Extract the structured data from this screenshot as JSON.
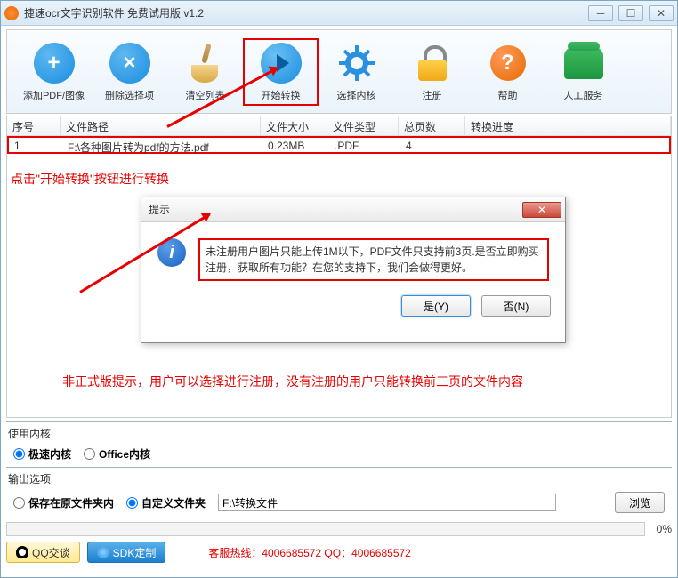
{
  "window": {
    "title": "捷速ocr文字识别软件 免费试用版 v1.2"
  },
  "toolbar": {
    "add": "添加PDF/图像",
    "delete": "删除选择项",
    "clear": "清空列表",
    "start": "开始转换",
    "engine": "选择内核",
    "register": "注册",
    "help": "帮助",
    "service": "人工服务"
  },
  "table": {
    "headers": {
      "seq": "序号",
      "path": "文件路径",
      "size": "文件大小",
      "type": "文件类型",
      "pages": "总页数",
      "progress": "转换进度"
    },
    "rows": [
      {
        "seq": "1",
        "path": "F:\\各种图片转为pdf的方法.pdf",
        "size": "0.23MB",
        "type": ".PDF",
        "pages": "4"
      }
    ]
  },
  "annotations": {
    "a1": "点击\"开始转换\"按钮进行转换",
    "a2": "非正式版提示，用户可以选择进行注册，没有注册的用户只能转换前三页的文件内容"
  },
  "dialog": {
    "title": "提示",
    "message": "未注册用户图片只能上传1M以下，PDF文件只支持前3页.是否立即购买注册，获取所有功能？在您的支持下，我们会做得更好。",
    "yes": "是(Y)",
    "no": "否(N)"
  },
  "engine": {
    "label": "使用内核",
    "fast": "极速内核",
    "office": "Office内核"
  },
  "output": {
    "label": "输出选项",
    "original": "保存在原文件夹内",
    "custom": "自定义文件夹",
    "path": "F:\\转换文件",
    "browse": "浏览"
  },
  "progress": {
    "text": "0%"
  },
  "footer": {
    "qq": "QQ交谈",
    "sdk": "SDK定制",
    "hotline": "客服热线：4006685572 QQ：4006685572"
  }
}
